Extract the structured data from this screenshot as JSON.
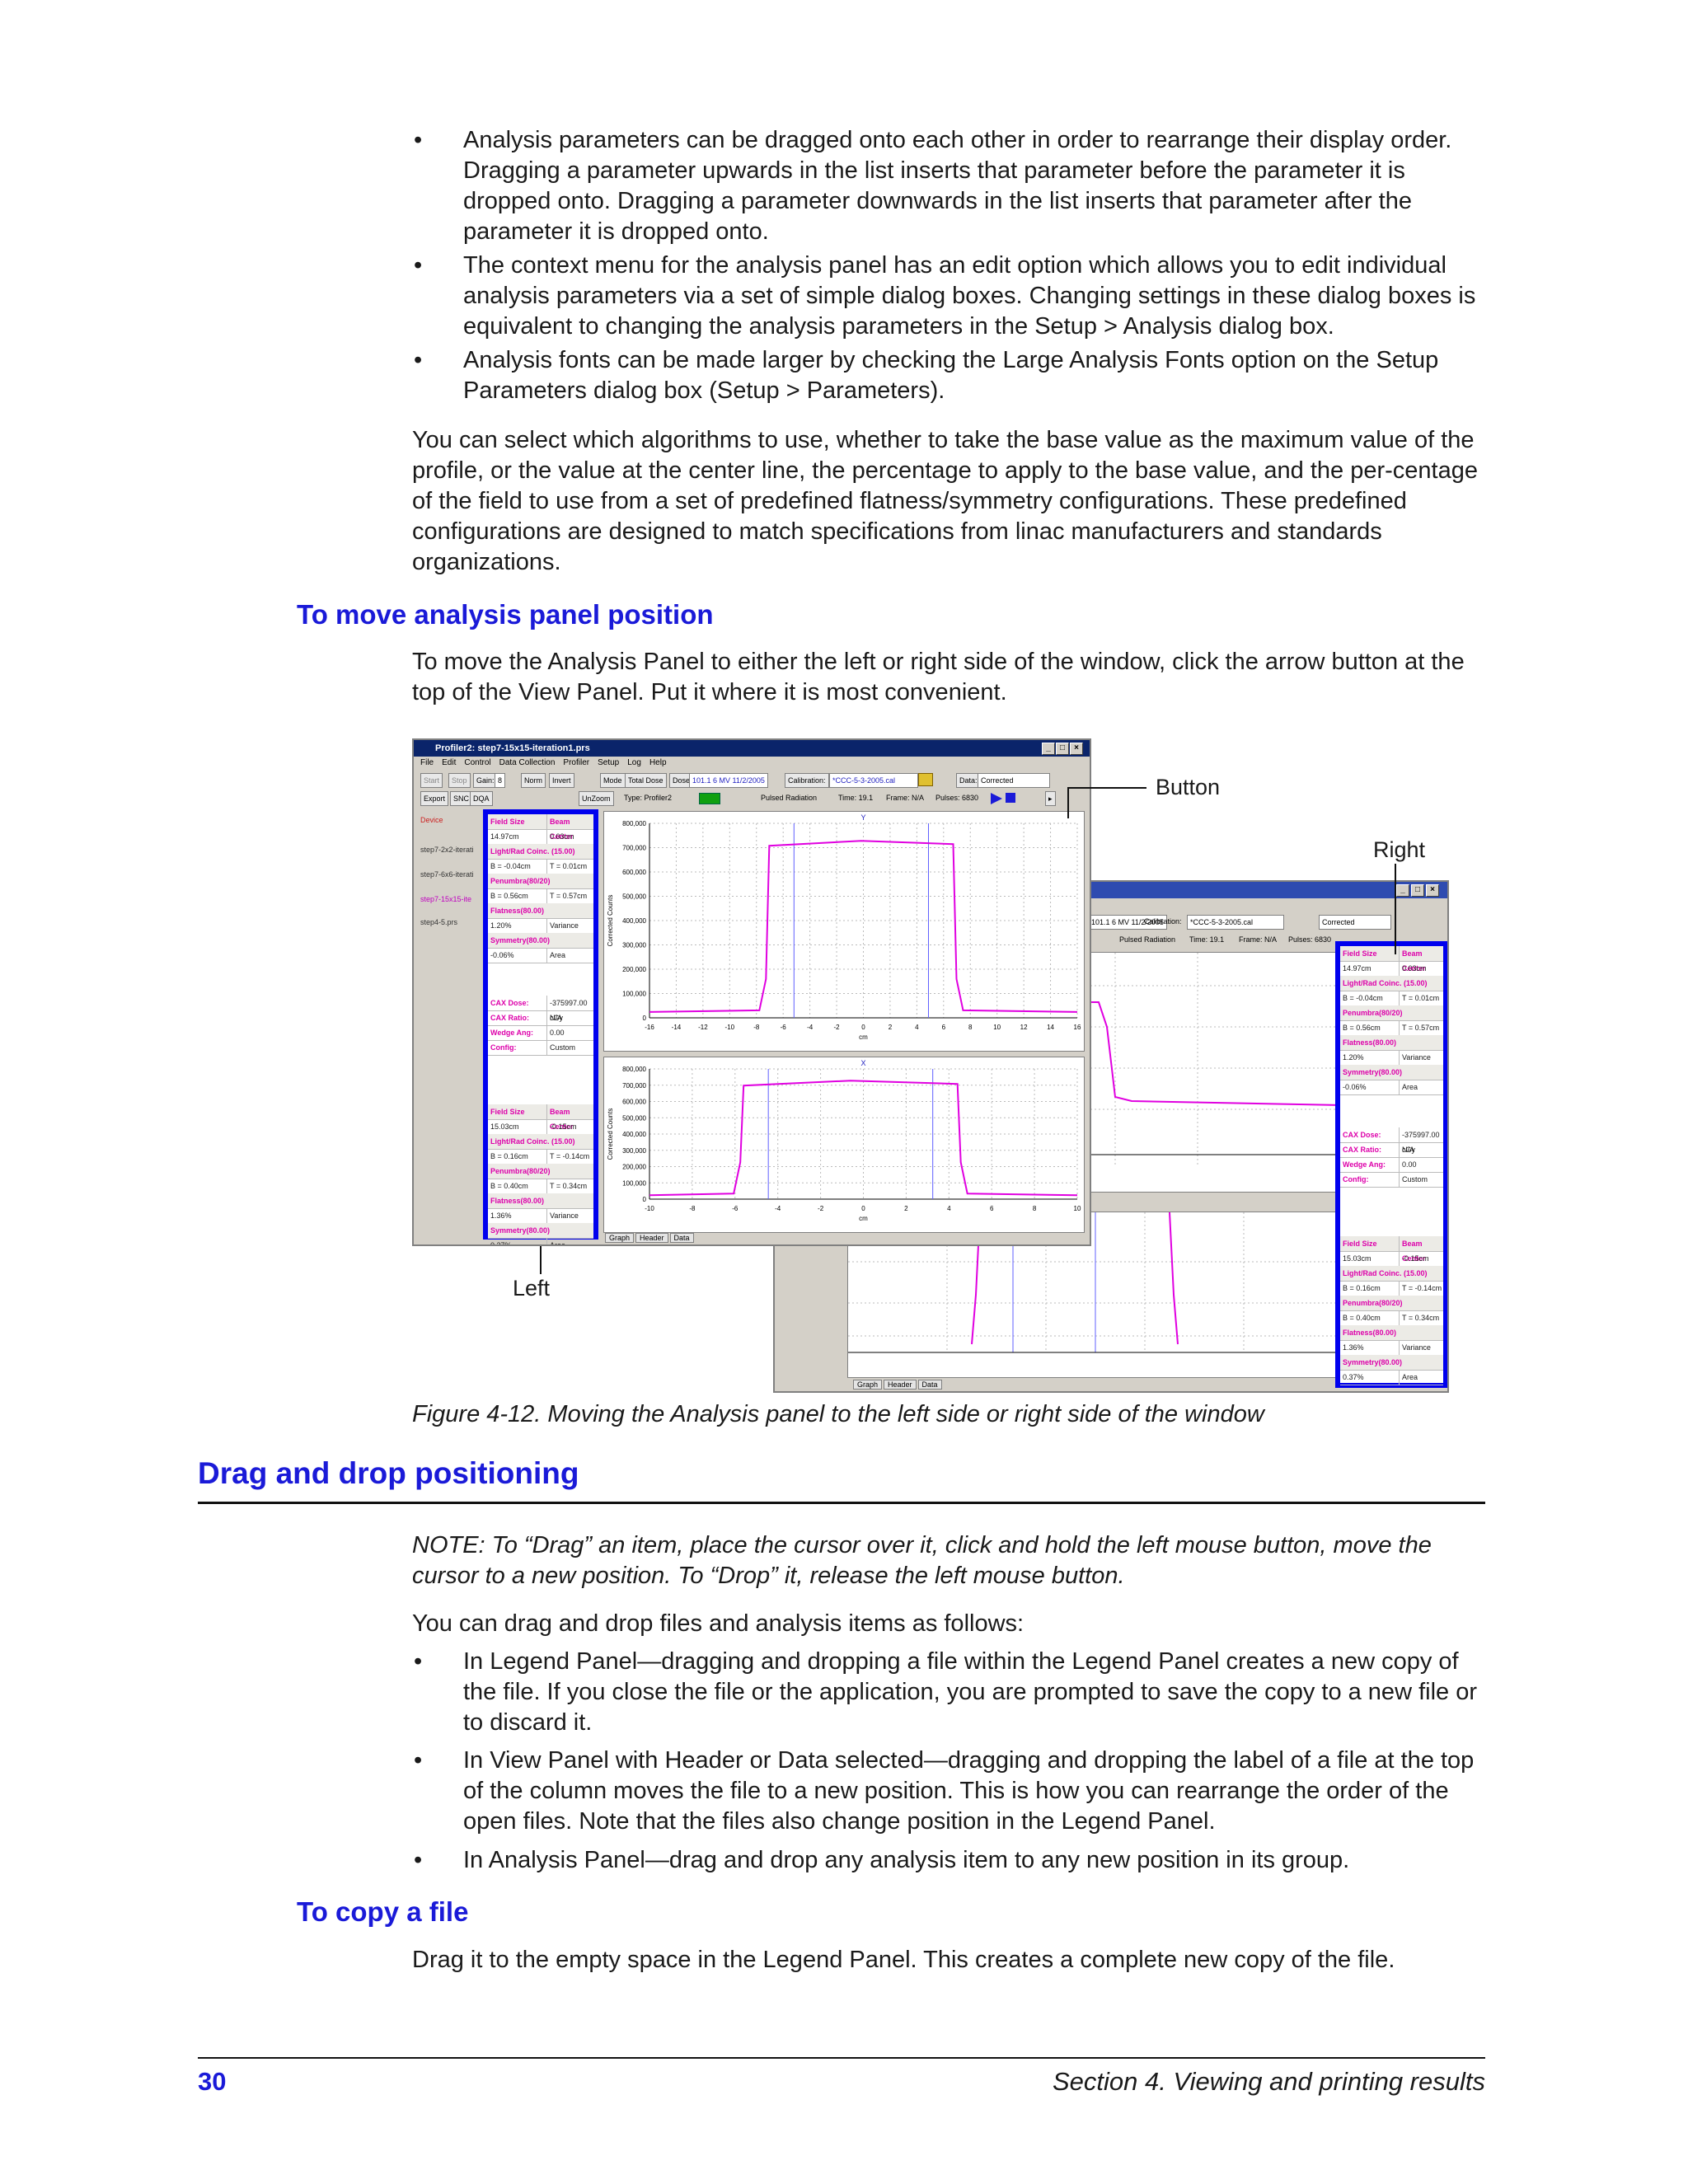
{
  "bullets_top": [
    "Analysis parameters can be dragged onto each other in order to rearrange their display order. Dragging a parameter upwards in the list inserts that parameter before the parameter it is dropped onto. Dragging a parameter downwards in the list inserts that parameter after the parameter it is dropped onto.",
    "The context menu for the analysis panel has an edit option which allows you to edit individual analysis parameters via a set of simple dialog boxes. Changing settings in these dialog boxes is equivalent to changing the analysis parameters in the Setup > Analysis dialog box.",
    "Analysis fonts can be made larger by checking the Large Analysis Fonts option on the Setup Parameters dialog box (Setup > Parameters)."
  ],
  "bullet_glyph": "•",
  "para_algorithms": "You can select which algorithms to use, whether to take the base value as the maximum value of the profile, or the value at the center line, the percentage to apply to the base value, and the per-centage of the field to use from a set of predefined flatness/symmetry configurations. These predefined configurations are designed to match specifications from linac manufacturers and standards organizations.",
  "heading_move": "To move analysis panel position",
  "para_move": "To move the Analysis Panel to either the left or right side of the window, click the arrow button at the top of the View Panel. Put it where it is most convenient.",
  "figure": {
    "callout_button": "Button",
    "callout_right": "Right",
    "callout_left": "Left",
    "caption": "Figure 4-12. Moving the Analysis panel to the left side or right side of the window",
    "win_title": "Profiler2: step7-15x15-iteration1.prs",
    "menu": [
      "File",
      "Edit",
      "Control",
      "Data Collection",
      "Profiler",
      "Setup",
      "Log",
      "Help"
    ],
    "toolbar": {
      "start": "Start",
      "stop": "Stop",
      "gain_label": "Gain:",
      "gain_value": "8",
      "norm": "Norm",
      "invert": "Invert",
      "mode_label": "Mode",
      "mode_value": "Total Dose",
      "dose_label": "Dose",
      "dose_value": "101.1 6 MV 11/2/2005",
      "calibration_label": "Calibration:",
      "calibration_value": "*CCC-5-3-2005.cal",
      "data_label": "Data:",
      "data_value": "Corrected",
      "export": "Export",
      "snc": "SNC",
      "dqa": "DQA",
      "unzoom": "UnZoom",
      "type": "Type: Profiler2",
      "pulsed": "Pulsed Radiation",
      "time": "Time: 19.1",
      "frame": "Frame: N/A",
      "pulses": "Pulses: 6830"
    },
    "legend_items": [
      "Device",
      "step7-2x2-iterati",
      "step7-6x6-iterati",
      "step7-15x15-ite",
      "step4-5.prs"
    ],
    "analysis_y": [
      {
        "h": [
          "Field Size",
          "Beam Center"
        ]
      },
      {
        "r": [
          "14.97cm",
          "0.03cm"
        ]
      },
      {
        "h": [
          "Light/Rad Coinc. (15.00)",
          ""
        ]
      },
      {
        "r": [
          "B = -0.04cm",
          "T = 0.01cm"
        ]
      },
      {
        "h": [
          "Penumbra(80/20)",
          ""
        ]
      },
      {
        "r": [
          "B = 0.56cm",
          "T = 0.57cm"
        ]
      },
      {
        "h": [
          "Flatness(80.00)",
          ""
        ]
      },
      {
        "r": [
          "1.20%",
          "Variance"
        ]
      },
      {
        "h": [
          "Symmetry(80.00)",
          ""
        ]
      },
      {
        "r": [
          "-0.06%",
          "Area"
        ]
      }
    ],
    "analysis_cax": [
      {
        "k": "CAX Dose:",
        "v": "-375997.00 cGy"
      },
      {
        "k": "CAX Ratio:",
        "v": "N/A"
      },
      {
        "k": "Wedge Ang:",
        "v": "0.00"
      },
      {
        "k": "Config:",
        "v": "Custom"
      }
    ],
    "analysis_x": [
      {
        "h": [
          "Field Size",
          "Beam Center"
        ]
      },
      {
        "r": [
          "15.03cm",
          "-0.15cm"
        ]
      },
      {
        "h": [
          "Light/Rad Coinc. (15.00)",
          ""
        ]
      },
      {
        "r": [
          "B = 0.16cm",
          "T = -0.14cm"
        ]
      },
      {
        "h": [
          "Penumbra(80/20)",
          ""
        ]
      },
      {
        "r": [
          "B = 0.40cm",
          "T = 0.34cm"
        ]
      },
      {
        "h": [
          "Flatness(80.00)",
          ""
        ]
      },
      {
        "r": [
          "1.36%",
          "Variance"
        ]
      },
      {
        "h": [
          "Symmetry(80.00)",
          ""
        ]
      },
      {
        "r": [
          "0.37%",
          "Area"
        ]
      }
    ],
    "graph_y_label": "Y",
    "graph_x_label": "X",
    "y_ticks": [
      "800,000",
      "700,000",
      "600,000",
      "500,000",
      "400,000",
      "300,000",
      "200,000",
      "100,000",
      "0"
    ],
    "y_axis_title": "Corrected Counts",
    "x_ticks_top": [
      "-16",
      "-14",
      "-12",
      "-10",
      "-8",
      "-6",
      "-4",
      "-2",
      "0",
      "2",
      "4",
      "6",
      "8",
      "10",
      "12",
      "14",
      "16"
    ],
    "x_ticks_bottom": [
      "-10",
      "-8",
      "-6",
      "-4",
      "-2",
      "0",
      "2",
      "4",
      "6",
      "8",
      "10"
    ],
    "x_unit": "cm",
    "tabs": [
      "Graph",
      "Header",
      "Data"
    ],
    "profile_color": "#e000e0",
    "panel_color": "#0000ee"
  },
  "heading_drag": "Drag and drop positioning",
  "note": "NOTE: To “Drag” an item, place the cursor over it, click and hold the left mouse button, move the cursor to a new position. To “Drop” it, release the left mouse button.",
  "para_drag_intro": "You can drag and drop files and analysis items as follows:",
  "bullets_drag": [
    "In Legend Panel—dragging and dropping a file within the Legend Panel creates a new copy of the file. If you close the file or the application, you are prompted to save the copy to a new file or to discard it.",
    "In View Panel with Header or Data selected—dragging and dropping the label of a file at the top of the column moves the file to a new position. This is how you can rearrange the order of the open files. Note that the files also change position in the Legend Panel.",
    "In Analysis Panel—drag and drop any analysis item to any new position in its group."
  ],
  "heading_copy": "To copy a file",
  "para_copy": "Drag it to the empty space in the Legend Panel. This creates a complete new copy of the file.",
  "footer": {
    "page": "30",
    "section": "Section 4. Viewing and printing results"
  }
}
